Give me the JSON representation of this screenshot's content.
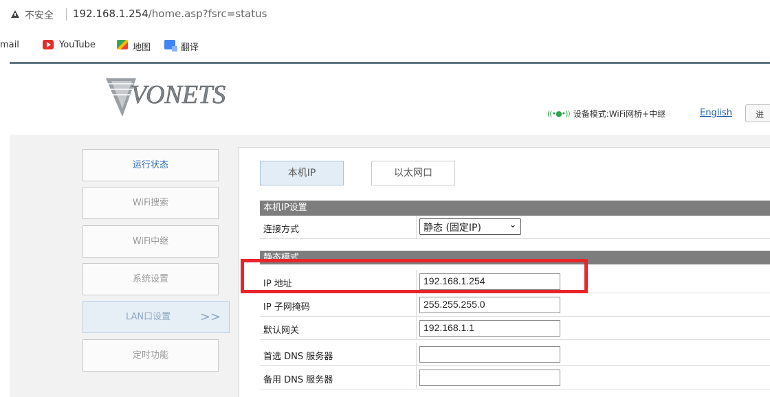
{
  "browser": {
    "insecure_label": "不安全",
    "url_host": "192.168.1.254",
    "url_path": "/home.asp?fsrc=status",
    "bookmarks": {
      "gmail": "mail",
      "youtube": "YouTube",
      "maps": "地图",
      "translate": "翻译"
    }
  },
  "header": {
    "logo_text": "VONETS",
    "mode_signal": "((•●•))",
    "mode_text": "设备模式:WiFi网桥+中继",
    "english_link": "English",
    "lang_button": "迸"
  },
  "sidebar": {
    "items": [
      {
        "label": "运行状态"
      },
      {
        "label": "WiFi搜索"
      },
      {
        "label": "WiFi中继"
      },
      {
        "label": "系统设置"
      },
      {
        "label": "LAN口设置",
        "arrow": ">>"
      },
      {
        "label": "定时功能"
      }
    ]
  },
  "tabs": [
    {
      "label": "本机IP"
    },
    {
      "label": "以太网口"
    }
  ],
  "section1": {
    "title": "本机IP设置",
    "connection_label": "连接方式",
    "connection_value": "静态 (固定IP)"
  },
  "section2": {
    "title": "静态模式",
    "rows": [
      {
        "label": "IP 地址",
        "value": "192.168.1.254"
      },
      {
        "label": "IP 子网掩码",
        "value": "255.255.255.0"
      },
      {
        "label": "默认网关",
        "value": "192.168.1.1"
      },
      {
        "label": "首选 DNS 服务器",
        "value": ""
      },
      {
        "label": "备用 DNS 服务器",
        "value": ""
      }
    ]
  },
  "colors": {
    "highlight_box": "#e8262a",
    "section_header": "#7d7d7d",
    "link": "#1a5fb4"
  }
}
